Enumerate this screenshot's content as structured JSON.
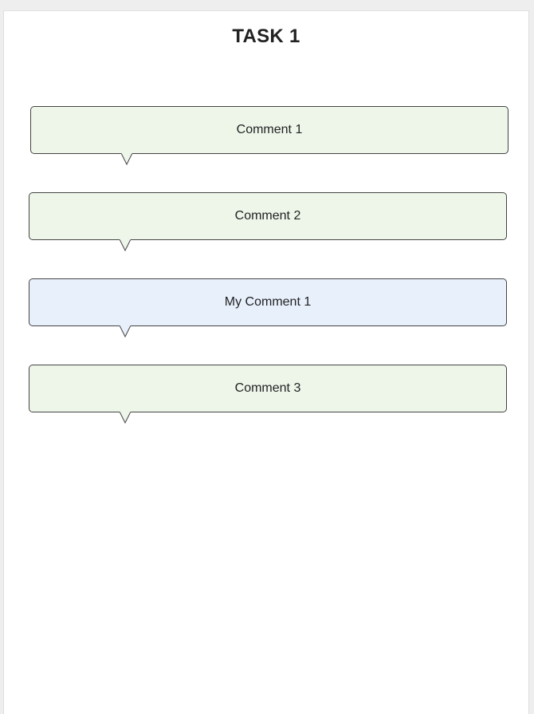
{
  "task": {
    "title": "TASK 1"
  },
  "comments": [
    {
      "text": "Comment 1",
      "kind": "other"
    },
    {
      "text": "Comment 2",
      "kind": "other"
    },
    {
      "text": "My Comment 1",
      "kind": "mine"
    },
    {
      "text": "Comment 3",
      "kind": "other"
    }
  ],
  "colors": {
    "other_bubble": "#eef6ea",
    "mine_bubble": "#e8f0fc",
    "bubble_border": "#444444"
  }
}
